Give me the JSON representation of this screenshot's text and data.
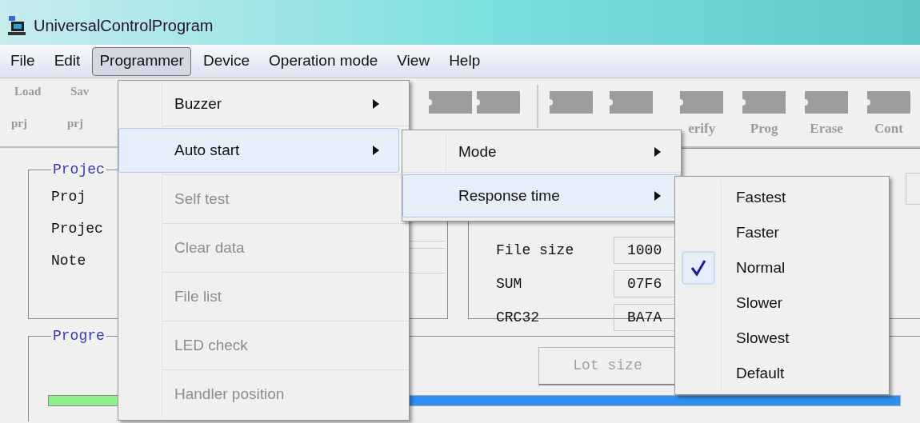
{
  "window": {
    "title": "UniversalControlProgram"
  },
  "menubar": [
    {
      "label": "File",
      "selected": false
    },
    {
      "label": "Edit",
      "selected": false
    },
    {
      "label": "Programmer",
      "selected": true
    },
    {
      "label": "Device",
      "selected": false
    },
    {
      "label": "Operation mode",
      "selected": false
    },
    {
      "label": "View",
      "selected": false
    },
    {
      "label": "Help",
      "selected": false
    }
  ],
  "toolbar": {
    "left": [
      {
        "top": "Load",
        "bottom": "prj"
      },
      {
        "top": "Sav",
        "bottom": "prj"
      }
    ],
    "right": [
      {
        "label": "erify"
      },
      {
        "label": "Prog"
      },
      {
        "label": "Erase"
      },
      {
        "label": "Cont"
      }
    ]
  },
  "project_group": {
    "title": "Projec",
    "rows": [
      "Proj",
      "Projec",
      "Note"
    ]
  },
  "file_group": {
    "rows": [
      {
        "label": "File size",
        "value": "1000"
      },
      {
        "label": "SUM",
        "value": "07F6"
      },
      {
        "label": "CRC32",
        "value": "BA7A"
      }
    ]
  },
  "progress_group": {
    "title": "Progre",
    "lot_size_button": {
      "label": "Lot size",
      "disabled": true
    },
    "progress_bar": {
      "level": 1
    }
  },
  "programmer_menu": [
    {
      "label": "Buzzer",
      "submenu": true,
      "disabled": false,
      "selected": false
    },
    {
      "label": "Auto start",
      "submenu": true,
      "disabled": false,
      "selected": true
    },
    {
      "label": "Self test",
      "submenu": false,
      "disabled": true,
      "selected": false
    },
    {
      "label": "Clear data",
      "submenu": false,
      "disabled": true,
      "selected": false
    },
    {
      "label": "File list",
      "submenu": false,
      "disabled": true,
      "selected": false
    },
    {
      "label": "LED check",
      "submenu": false,
      "disabled": true,
      "selected": false
    },
    {
      "label": "Handler position",
      "submenu": false,
      "disabled": true,
      "selected": false
    }
  ],
  "auto_start_menu": [
    {
      "label": "Mode",
      "submenu": true,
      "selected": false
    },
    {
      "label": "Response time",
      "submenu": true,
      "selected": true
    }
  ],
  "response_time_menu": [
    {
      "label": "Fastest",
      "checked": false
    },
    {
      "label": "Faster",
      "checked": false
    },
    {
      "label": "Normal",
      "checked": true
    },
    {
      "label": "Slower",
      "checked": false
    },
    {
      "label": "Slowest",
      "checked": false
    },
    {
      "label": "Default",
      "checked": false
    }
  ]
}
